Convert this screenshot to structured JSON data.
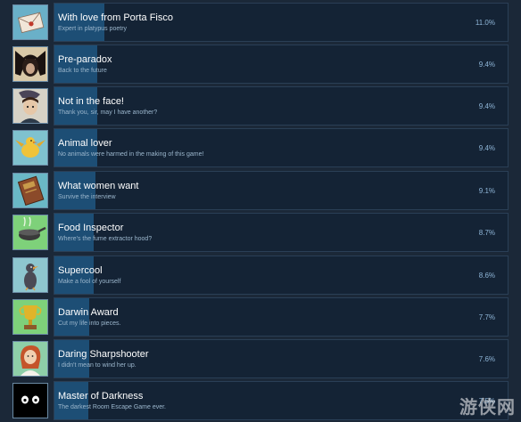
{
  "achievements": [
    {
      "title": "With love from Porta Fisco",
      "description": "Expert in platypus poetry",
      "percent": "11.0%",
      "percent_value": 11.0,
      "icon": "envelope-icon"
    },
    {
      "title": "Pre-paradox",
      "description": "Back to the future",
      "percent": "9.4%",
      "percent_value": 9.4,
      "icon": "shadowy-figure-icon"
    },
    {
      "title": "Not in the face!",
      "description": "Thank you, sir, may I have another?",
      "percent": "9.4%",
      "percent_value": 9.4,
      "icon": "character-portrait-icon"
    },
    {
      "title": "Animal lover",
      "description": "No animals were harmed in the making of this game!",
      "percent": "9.4%",
      "percent_value": 9.4,
      "icon": "yellow-bird-icon"
    },
    {
      "title": "What women want",
      "description": "Survive the interview",
      "percent": "9.1%",
      "percent_value": 9.1,
      "icon": "book-icon"
    },
    {
      "title": "Food Inspector",
      "description": "Where's the fume extractor hood?",
      "percent": "8.7%",
      "percent_value": 8.7,
      "icon": "cooking-pot-icon"
    },
    {
      "title": "Supercool",
      "description": "Make a fool of yourself",
      "percent": "8.6%",
      "percent_value": 8.6,
      "icon": "bird-figure-icon"
    },
    {
      "title": "Darwin Award",
      "description": "Cut my life into pieces.",
      "percent": "7.7%",
      "percent_value": 7.7,
      "icon": "trophy-icon"
    },
    {
      "title": "Daring Sharpshooter",
      "description": "I didn't mean to wind her up.",
      "percent": "7.6%",
      "percent_value": 7.6,
      "icon": "redhead-character-icon"
    },
    {
      "title": "Master of Darkness",
      "description": "The darkest Room Escape Game ever.",
      "percent": "7.5%",
      "percent_value": 7.5,
      "icon": "glowing-eyes-icon"
    }
  ],
  "watermark": "游侠网",
  "colors": {
    "background": "#1b2838",
    "panel": "#142335",
    "progress_bar": "#1f5680",
    "title_text": "#ffffff",
    "description_text": "#9bb6cc",
    "percent_text": "#8fb6d8"
  }
}
